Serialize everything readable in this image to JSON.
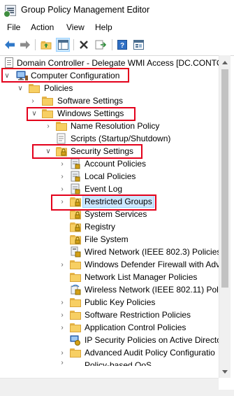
{
  "window": {
    "title": "Group Policy Management Editor",
    "icon": "group-policy-editor-icon"
  },
  "menu": [
    "File",
    "Action",
    "View",
    "Help"
  ],
  "toolbar": {
    "buttons": [
      "back-arrow-icon",
      "forward-arrow-icon",
      "up-folder-icon",
      "show-hide-tree-icon",
      "delete-icon",
      "export-list-icon",
      "help-icon",
      "properties-view-icon"
    ]
  },
  "tree": {
    "root": "Domain Controller - Delegate WMI Access [DC.CONTO",
    "computer_configuration": "Computer Configuration",
    "policies": "Policies",
    "software_settings": "Software Settings",
    "windows_settings": "Windows Settings",
    "name_resolution_policy": "Name Resolution Policy",
    "scripts": "Scripts (Startup/Shutdown)",
    "security_settings": "Security Settings",
    "account_policies": "Account Policies",
    "local_policies": "Local Policies",
    "event_log": "Event Log",
    "restricted_groups": "Restricted Groups",
    "system_services": "System Services",
    "registry": "Registry",
    "file_system": "File System",
    "wired_network": "Wired Network (IEEE 802.3) Policies",
    "defender_firewall": "Windows Defender Firewall with Adv",
    "network_list_manager": "Network List Manager Policies",
    "wireless_network": "Wireless Network (IEEE 802.11) Polici",
    "public_key_policies": "Public Key Policies",
    "software_restriction": "Software Restriction Policies",
    "application_control": "Application Control Policies",
    "ip_security": "IP Security Policies on Active Directo",
    "advanced_audit": "Advanced Audit Policy Configuratio",
    "partial_last": "Policy-based QoS"
  },
  "highlight_color": "#e3001b",
  "selection_color": "#cce8ff"
}
